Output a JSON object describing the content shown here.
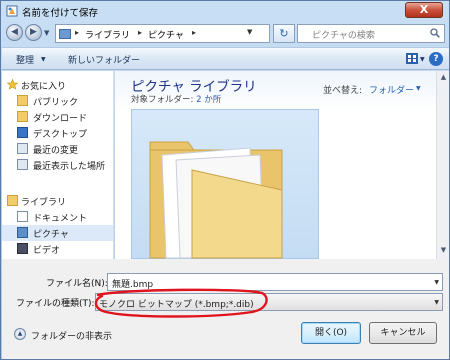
{
  "window": {
    "title": "名前を付けて保存",
    "close": "X"
  },
  "address": {
    "crumbs": [
      "ライブラリ",
      "ピクチャ"
    ],
    "search_placeholder": "ピクチャの検索"
  },
  "toolbar": {
    "organize": "整理",
    "new_folder": "新しいフォルダー",
    "help": "?"
  },
  "nav": {
    "favorites_header": "お気に入り",
    "favorites": [
      "パブリック",
      "ダウンロード",
      "デスクトップ",
      "最近の変更",
      "最近表示した場所"
    ],
    "libraries_header": "ライブラリ",
    "libraries": [
      "ドキュメント",
      "ピクチャ",
      "ビデオ"
    ],
    "selected": "ピクチャ"
  },
  "content": {
    "library_title": "ピクチャ ライブラリ",
    "target_label": "対象フォルダー:",
    "target_count": "2 か所",
    "sort_label": "並べ替え:",
    "sort_value": "フォルダー"
  },
  "form": {
    "filename_label": "ファイル名(N):",
    "filename_value": "無題.bmp",
    "filetype_label": "ファイルの種類(T):",
    "filetype_value": "モノクロ ビットマップ (*.bmp;*.dib)"
  },
  "footer": {
    "hide_folders": "フォルダーの非表示",
    "open_button": "開く(O)",
    "cancel_button": "キャンセル"
  },
  "colors": {
    "annotation_oval": "#e0141e",
    "title_accent": "#1e3287",
    "link": "#2462b3"
  }
}
